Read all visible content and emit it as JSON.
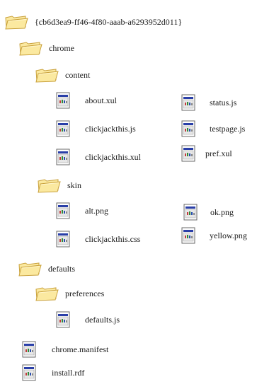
{
  "tree": {
    "root": "{cb6d3ea9-ff46-4f80-aaab-a6293952d011}",
    "chrome": "chrome",
    "content": "content",
    "content_files": {
      "about": "about.xul",
      "status": "status.js",
      "clickjack_js": "clickjackthis.js",
      "testpage": "testpage.js",
      "clickjack_xul": "clickjackthis.xul",
      "pref": "pref.xul"
    },
    "skin": "skin",
    "skin_files": {
      "alt": "alt.png",
      "ok": "ok.png",
      "css": "clickjackthis.css",
      "yellow": "yellow.png"
    },
    "defaults": "defaults",
    "preferences": "preferences",
    "pref_files": {
      "defaults_js": "defaults.js"
    },
    "manifest": "chrome.manifest",
    "install": "install.rdf"
  },
  "colors": {
    "folder_fill": "#fbe9a0",
    "folder_stroke": "#c9a13c",
    "file_border": "#6a6a6a",
    "file_titlebar": "#2a3fa8",
    "file_body": "#e7e7e7"
  }
}
